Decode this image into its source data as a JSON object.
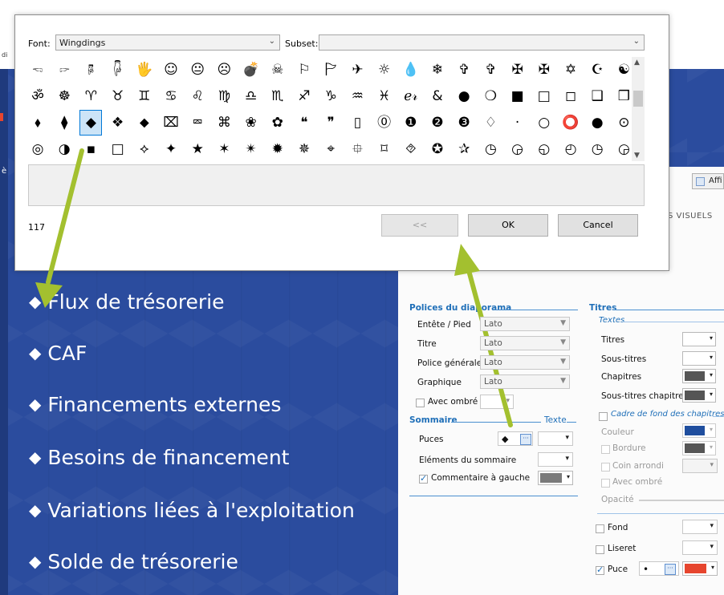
{
  "slide": {
    "bullet_glyph": "◆",
    "bullets": [
      "Flux de trésorerie",
      "CAF",
      "Financements externes",
      "Besoins de financement",
      "Variations liées à l'exploitation",
      "Solde de trésorerie"
    ]
  },
  "dialog": {
    "font_label": "Font:",
    "font_value": "Wingdings",
    "subset_label": "Subset:",
    "subset_value": "",
    "char_code": "117",
    "buttons": {
      "prev": "<<",
      "ok": "OK",
      "cancel": "Cancel"
    },
    "grid_rows": [
      [
        "🖘",
        "🖙",
        "🖗",
        "🖟",
        "🖐",
        "☺",
        "😐",
        "☹",
        "💣",
        "☠",
        "⚐",
        "🏱",
        "✈",
        "☼",
        "💧",
        "❄",
        "✞",
        "✞",
        "✠",
        "✠",
        "✡",
        "☪",
        "☯"
      ],
      [
        "ॐ",
        "☸",
        "♈",
        "♉",
        "♊",
        "♋",
        "♌",
        "♍",
        "♎",
        "♏",
        "♐",
        "♑",
        "♒",
        "♓",
        "ℯ𝓇",
        "&",
        "●",
        "❍",
        "■",
        "□",
        "◻",
        "❑",
        "❒"
      ],
      [
        "⬧",
        "⧫",
        "◆",
        "❖",
        "⬥",
        "⌧",
        "⮹",
        "⌘",
        "❀",
        "✿",
        "❝",
        "❞",
        "▯",
        "⓪",
        "❶",
        "❷",
        "❸",
        "♢",
        "·",
        "○",
        "⭕",
        "●",
        "⊙"
      ],
      [
        "◎",
        "◑",
        "▪",
        "□",
        "⟡",
        "✦",
        "★",
        "✶",
        "✴",
        "✹",
        "✵",
        "⌖",
        "⯐",
        "⌑",
        "⯑",
        "✪",
        "✰",
        "◷",
        "◶",
        "◵",
        "◴",
        "◷",
        "◶"
      ]
    ],
    "selected_cell": {
      "row": 2,
      "col": 2
    }
  },
  "settings": {
    "affi_label": "Affi",
    "tab_visuels": "S   VISUELS",
    "polices_title": "Polices du diaporama",
    "polices_rows": [
      {
        "label": "Entête / Pied",
        "value": "Lato"
      },
      {
        "label": "Titre",
        "value": "Lato"
      },
      {
        "label": "Police générale",
        "value": "Lato"
      },
      {
        "label": "Graphique",
        "value": "Lato"
      }
    ],
    "avec_ombre": "Avec ombré",
    "sommaire_title": "Sommaire",
    "texte_title": "Texte",
    "puces_label": "Puces",
    "puces_value": "◆",
    "elements_label": "Eléments du sommaire",
    "commentaire_label": "Commentaire à gauche",
    "titres_title": "Titres",
    "textes_sub": "Textes",
    "titres_rows": [
      "Titres",
      "Sous-titres",
      "Chapitres",
      "Sous-titres chapitres"
    ],
    "cadre_sub": "Cadre de fond des chapitres",
    "couleur_label": "Couleur",
    "bordure_label": "Bordure",
    "coin_label": "Coin arrondi",
    "ombre_label": "Avec ombré",
    "opacite_label": "Opacité",
    "fond_label": "Fond",
    "liseret_label": "Liseret",
    "puce_label": "Puce",
    "puce_value": "•"
  },
  "colors": {
    "slide_blue": "#2b4c9e",
    "accent_blue": "#1f6fb8",
    "arrow_green": "#a3c02f",
    "puce_red": "#e6452e",
    "swatch_dark": "#555555",
    "swatch_blue": "#1f4e9e"
  },
  "clip": {
    "left_text": "di",
    "left_sym": "è"
  }
}
